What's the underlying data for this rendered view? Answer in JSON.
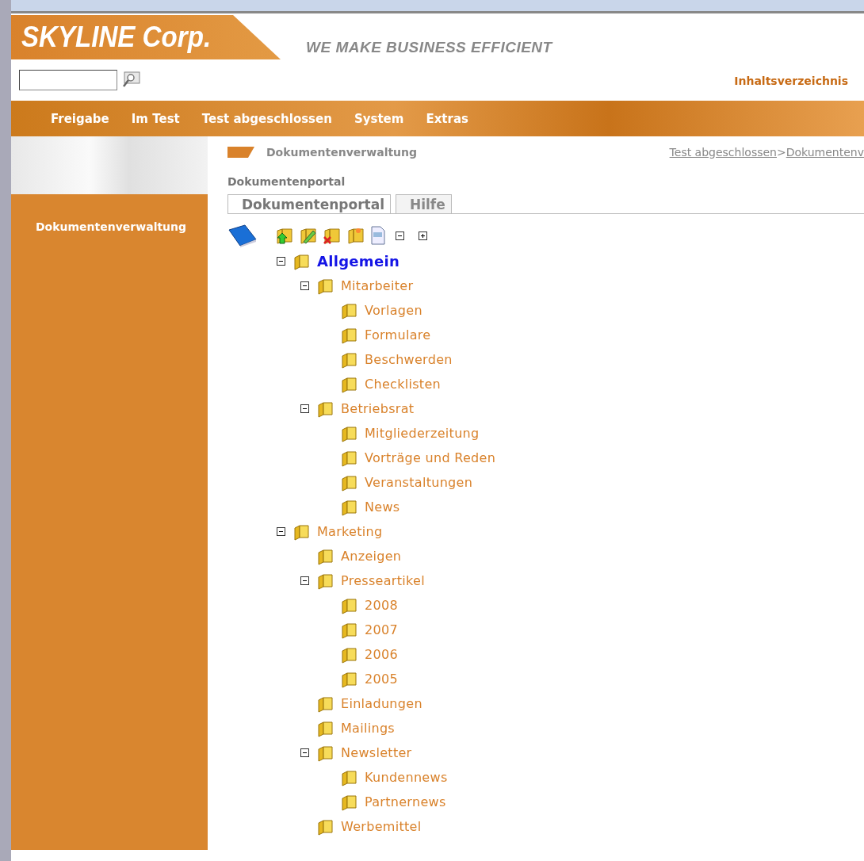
{
  "header": {
    "logo": "SKYLINE Corp.",
    "slogan": "WE MAKE BUSINESS EFFICIENT"
  },
  "top_links": [
    "Inhaltsverzeichnis"
  ],
  "nav": [
    "Freigabe",
    "Im Test",
    "Test abgeschlossen",
    "System",
    "Extras"
  ],
  "sidebar": {
    "items": [
      {
        "label": "Dokumentenverwaltung"
      }
    ]
  },
  "page_title": "Dokumentenverwaltung",
  "breadcrumb": [
    {
      "label": "Test abgeschlossen"
    },
    {
      "label": ">",
      "kind": "sep"
    },
    {
      "label": "Dokumentenv"
    }
  ],
  "section_title": "Dokumentenportal",
  "tabs": [
    {
      "label": "Dokumentenportal",
      "selected": true
    },
    {
      "label": "Hilfe",
      "selected": false
    }
  ],
  "tree": [
    {
      "label": "Allgemein",
      "selected": true,
      "expanded": true,
      "children": [
        {
          "label": "Mitarbeiter",
          "selected": false,
          "expanded": true,
          "children": [
            {
              "label": "Vorlagen",
              "selected": false
            },
            {
              "label": "Formulare",
              "selected": false
            },
            {
              "label": "Beschwerden",
              "selected": false
            },
            {
              "label": "Checklisten",
              "selected": false
            }
          ]
        },
        {
          "label": "Betriebsrat",
          "selected": false,
          "expanded": true,
          "children": [
            {
              "label": "Mitgliederzeitung",
              "selected": false
            },
            {
              "label": "Vorträge und Reden",
              "selected": false
            },
            {
              "label": "Veranstaltungen",
              "selected": false
            },
            {
              "label": "News",
              "selected": false
            }
          ]
        }
      ]
    },
    {
      "label": "Marketing",
      "selected": false,
      "expanded": true,
      "children": [
        {
          "label": "Anzeigen",
          "selected": false
        },
        {
          "label": "Presseartikel",
          "selected": false,
          "expanded": true,
          "children": [
            {
              "label": "2008",
              "selected": false
            },
            {
              "label": "2007",
              "selected": false
            },
            {
              "label": "2006",
              "selected": false
            },
            {
              "label": "2005",
              "selected": false
            }
          ]
        },
        {
          "label": "Einladungen",
          "selected": false
        },
        {
          "label": "Mailings",
          "selected": false
        },
        {
          "label": "Newsletter",
          "selected": false,
          "expanded": true,
          "children": [
            {
              "label": "Kundennews",
              "selected": false
            },
            {
              "label": "Partnernews",
              "selected": false
            }
          ]
        },
        {
          "label": "Werbemittel",
          "selected": false
        }
      ]
    }
  ]
}
